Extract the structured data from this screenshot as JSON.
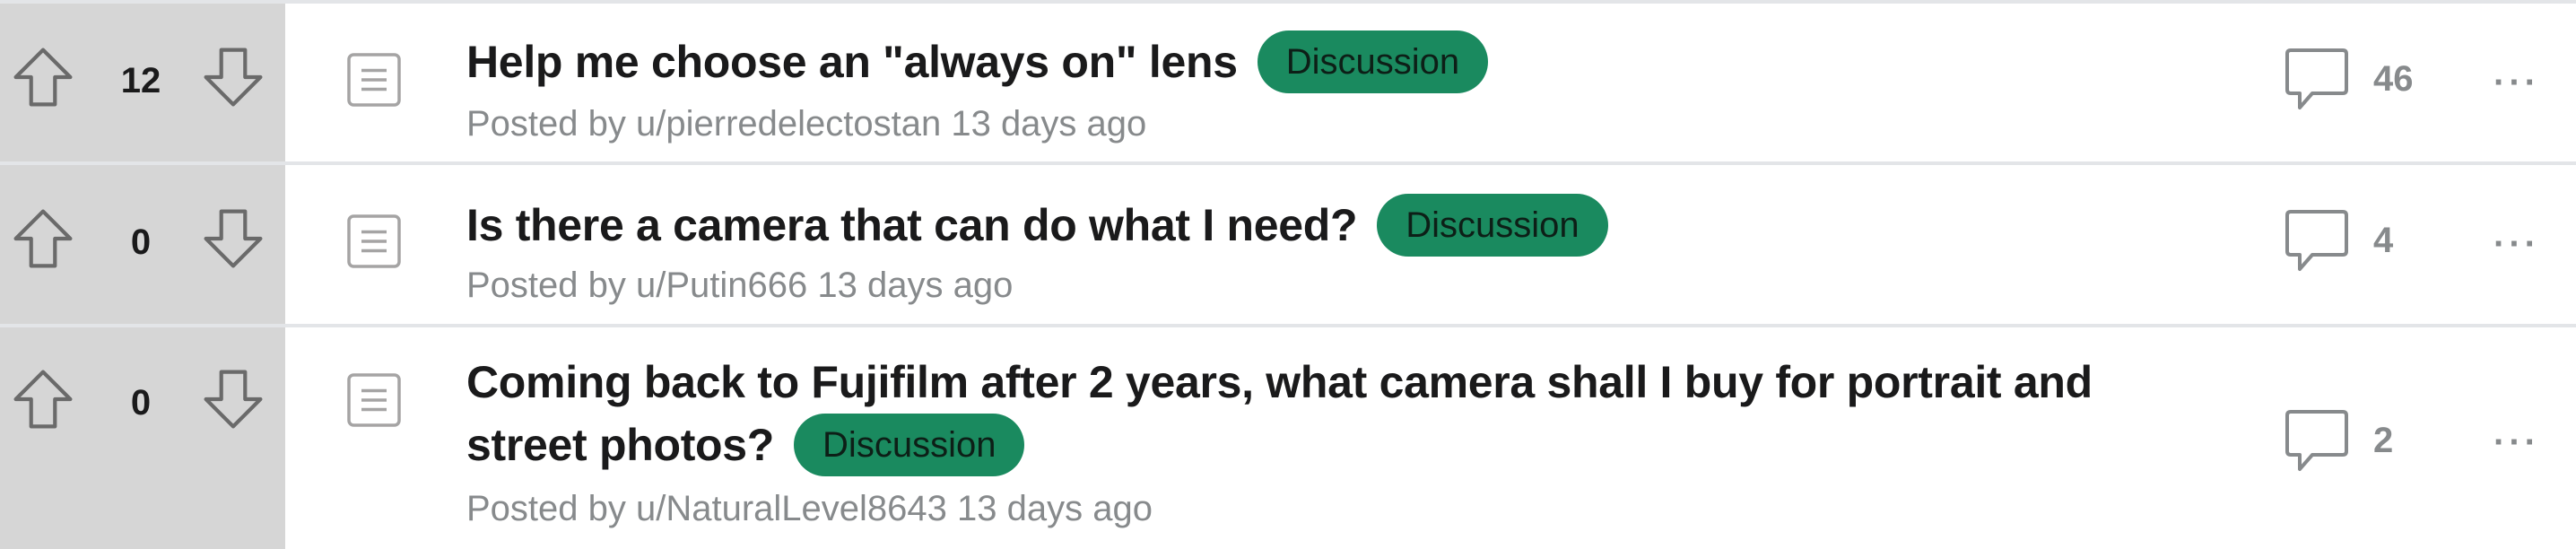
{
  "posts": [
    {
      "score": "12",
      "title": "Help me choose an \"always on\" lens",
      "flair": "Discussion",
      "meta": "Posted by u/pierredelectostan 13 days ago",
      "comments": "46",
      "more": "···"
    },
    {
      "score": "0",
      "title": "Is there a camera that can do what I need?",
      "flair": "Discussion",
      "meta": "Posted by u/Putin666 13 days ago",
      "comments": "4",
      "more": "···"
    },
    {
      "score": "0",
      "title": "Coming back to Fujifilm after 2 years, what camera shall I buy for portrait and street photos?",
      "flair": "Discussion",
      "meta": "Posted by u/NaturalLevel8643 13 days ago",
      "comments": "2",
      "more": "···"
    }
  ],
  "icons": {
    "upvote": "upvote-arrow-icon",
    "downvote": "downvote-arrow-icon",
    "post_type": "text-post-icon",
    "comments": "comment-bubble-icon",
    "more": "more-options-icon"
  },
  "colors": {
    "flair_bg": "#1a8a5f",
    "vote_column_bg": "#d6d6d6",
    "meta_text": "#878a8c",
    "title_text": "#1a1a1b"
  }
}
